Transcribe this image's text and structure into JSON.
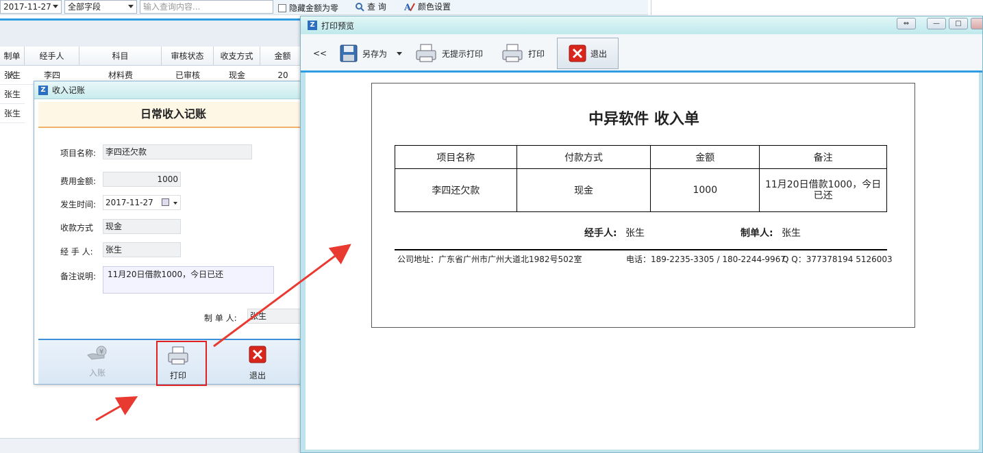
{
  "main": {
    "toolbar": {
      "date": "2017-11-27",
      "field_select": "全部字段",
      "search_placeholder": "输入查询内容...",
      "hide_amount_label": "隐藏金额为零",
      "query_label": "查 询",
      "color_label": "颜色设置"
    },
    "grid": {
      "columns": [
        "制单人",
        "经手人",
        "科目",
        "审核状态",
        "收支方式",
        "金额"
      ],
      "rows": [
        [
          "张生",
          "李四",
          "材料费",
          "已审核",
          "现金",
          "20"
        ],
        [
          "张生",
          "",
          "",
          "",
          "",
          ""
        ],
        [
          "张生",
          "",
          "",
          "",
          "",
          ""
        ]
      ]
    }
  },
  "income_dialog": {
    "title": "收入记账",
    "header": "日常收入记账",
    "fields": {
      "project_label": "项目名称:",
      "project_value": "李四还欠款",
      "amount_label": "费用金额:",
      "amount_value": "1000",
      "date_label": "发生时间:",
      "date_value": "2017-11-27",
      "method_label": "收款方式",
      "method_value": "现金",
      "handler_label": "经 手 人:",
      "handler_value": "张生",
      "note_label": "备注说明:",
      "note_value": "11月20日借款1000，今日已还",
      "maker_label": "制 单 人:",
      "maker_value": "张生"
    },
    "buttons": {
      "post": "入账",
      "print": "打印",
      "exit": "退出"
    }
  },
  "preview": {
    "title": "打印预览",
    "toolbar": {
      "back": "<<",
      "save_as": "另存为",
      "silent_print": "无提示打印",
      "print": "打印",
      "exit": "退出"
    },
    "receipt": {
      "title": "中异软件  收入单",
      "columns": [
        "项目名称",
        "付款方式",
        "金额",
        "备注"
      ],
      "row": [
        "李四还欠款",
        "现金",
        "1000",
        "11月20日借款1000，今日已还"
      ],
      "handler_label": "经手人:",
      "handler_value": "张生",
      "maker_label": "制单人:",
      "maker_value": "张生",
      "address": "公司地址：广东省广州市广州大道北1982号502室",
      "phone": "电话：189-2235-3305 / 180-2244-9967",
      "qq": "Q Q：377378194 5126003"
    }
  },
  "colors": {
    "accent_blue": "#2f9be0",
    "highlight_red": "#e02020",
    "header_orange": "#f0b26a"
  }
}
